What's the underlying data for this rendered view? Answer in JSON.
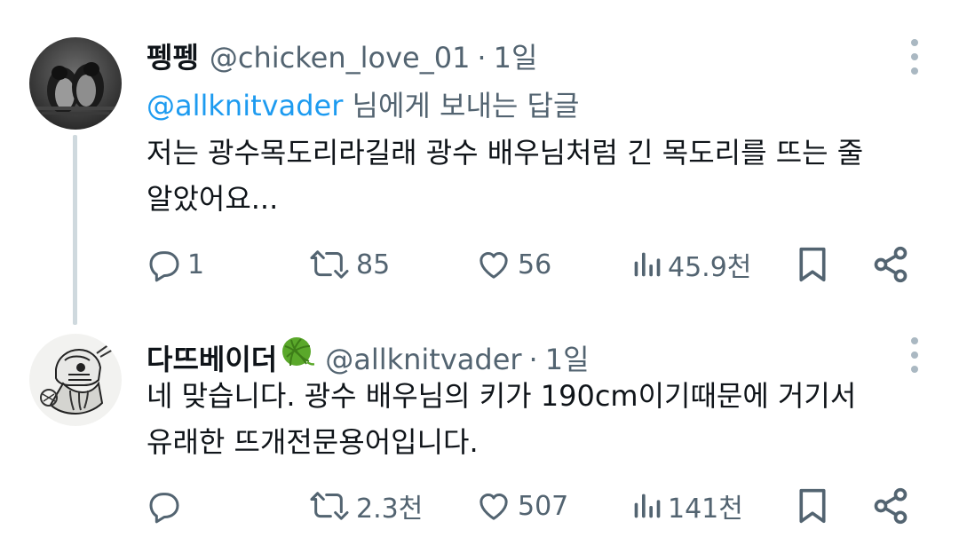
{
  "tweets": [
    {
      "display_name": "펭펭",
      "handle": "@chicken_love_01",
      "separator": "·",
      "time": "1일",
      "reply_mention": "@allknitvader",
      "reply_suffix": " 님에게 보내는 답글",
      "body_lines": [
        "저는 광수목도리라길래 광수 배우님처럼 긴 목도리를 뜨는 줄",
        "알았어요..."
      ],
      "avatar_icon": "penguin-photo-avatar",
      "stats": {
        "replies": "1",
        "retweets": "85",
        "likes": "56",
        "views": "45.9천"
      }
    },
    {
      "display_name": "다뜨베이더",
      "name_emoji": "yarn-ball-emoji",
      "handle": "@allknitvader",
      "separator": "·",
      "time": "1일",
      "body_lines": [
        "네 맞습니다. 광수 배우님의 키가 190cm이기때문에 거기서",
        "유래한 뜨개전문용어입니다."
      ],
      "avatar_icon": "knitting-vader-avatar",
      "stats": {
        "replies": "",
        "retweets": "2.3천",
        "likes": "507",
        "views": "141천"
      }
    }
  ],
  "colors": {
    "text_primary": "#0f1419",
    "text_secondary": "#536471",
    "link": "#1d9bf0",
    "thread_line": "#cfd9de",
    "yarn_green": "#5aa82a"
  }
}
